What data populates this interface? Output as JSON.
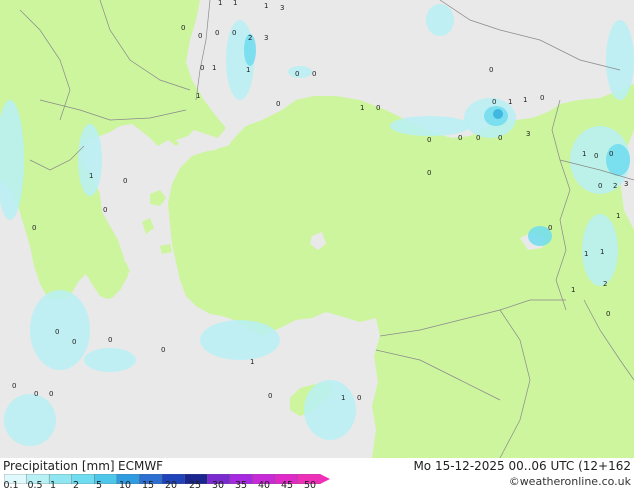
{
  "map": {
    "colors": {
      "sea": "#e9e9e9",
      "land": "#ccf59e",
      "border": "#8a8a8a",
      "precip_light": "#b7f0f5",
      "precip_medium": "#6fdcef",
      "precip_heavy": "#3fb7e0"
    },
    "point_labels": [
      "1",
      "1",
      "1",
      "3",
      "3",
      "2",
      "0",
      "0",
      "0",
      "0",
      "0",
      "1",
      "1",
      "1",
      "0",
      "0",
      "0",
      "1",
      "0",
      "0",
      "0",
      "0",
      "0",
      "0",
      "1",
      "1",
      "0",
      "3",
      "0",
      "0",
      "1",
      "0",
      "0",
      "2",
      "0",
      "3",
      "1",
      "0",
      "1",
      "1",
      "2",
      "1",
      "0",
      "1",
      "0",
      "0",
      "0",
      "0",
      "0",
      "0",
      "0",
      "1",
      "0",
      "0",
      "0",
      "0",
      "1",
      "0"
    ]
  },
  "footer": {
    "legend_title": "Precipitation [mm]",
    "model": "ECMWF",
    "valid_time": "Mo 15-12-2025 00..06 UTC (12+162",
    "credit": "©weatheronline.co.uk"
  },
  "legend": {
    "ticks": [
      "0.1",
      "0.5",
      "1",
      "2",
      "5",
      "10",
      "15",
      "20",
      "25",
      "30",
      "35",
      "40",
      "45",
      "50"
    ],
    "colors": [
      "#dff8fb",
      "#b7f0f5",
      "#8fe6f0",
      "#6fdcef",
      "#4fc7ea",
      "#2f9be0",
      "#2d6fd0",
      "#1f43b8",
      "#1a2590",
      "#7a2bd0",
      "#a52ae0",
      "#c82ad8",
      "#e02ac8",
      "#ee2fb8"
    ]
  }
}
